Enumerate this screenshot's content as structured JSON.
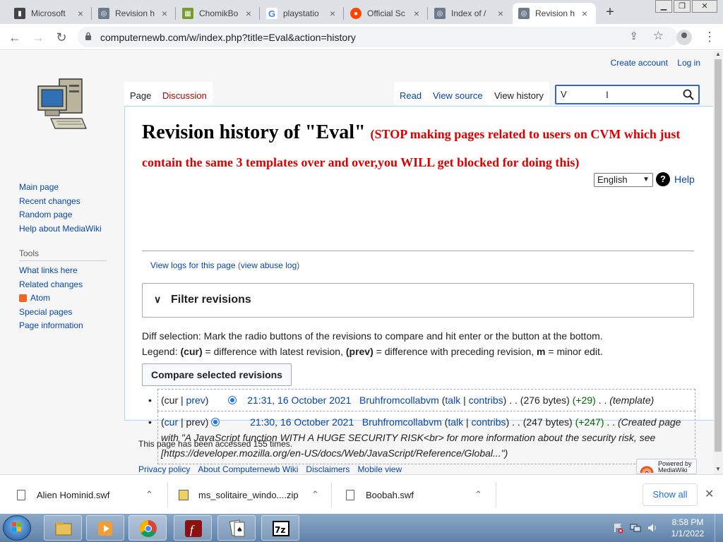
{
  "browser": {
    "tabs": [
      {
        "label": "Microsoft",
        "icon": "microsoft-icon"
      },
      {
        "label": "Revision h",
        "icon": "computernewb-icon"
      },
      {
        "label": "ChomikBo",
        "icon": "chomikbox-icon"
      },
      {
        "label": "playstatio",
        "icon": "google-icon"
      },
      {
        "label": "Official Sc",
        "icon": "reddit-icon"
      },
      {
        "label": "Index of /",
        "icon": "computernewb-icon"
      },
      {
        "label": "Revision h",
        "icon": "computernewb-icon",
        "active": true
      }
    ],
    "url": "computernewb.com/w/index.php?title=Eval&action=history"
  },
  "personal": {
    "create_account": "Create account",
    "log_in": "Log in"
  },
  "sidebar": {
    "nav": [
      "Main page",
      "Recent changes",
      "Random page",
      "Help about MediaWiki"
    ],
    "tools_heading": "Tools",
    "tools": [
      "What links here",
      "Related changes",
      "Atom",
      "Special pages",
      "Page information"
    ]
  },
  "tabs": {
    "page": "Page",
    "discussion": "Discussion",
    "read": "Read",
    "view_source": "View source",
    "view_history": "View history"
  },
  "search": {
    "value": "V"
  },
  "heading": {
    "title": "Revision history of \"Eval\"",
    "warning": "(STOP making pages related to users on CVM which just contain the same 3 templates over and over,you WILL get blocked for doing this)"
  },
  "language": {
    "selected": "English"
  },
  "help_label": "Help",
  "subtitle": {
    "view_logs": "View logs for this page",
    "abuse_open": " (",
    "abuse_log": "view abuse log",
    "abuse_close": ")"
  },
  "filter": {
    "label": "Filter revisions"
  },
  "legend": {
    "line1": "Diff selection: Mark the radio buttons of the revisions to compare and hit enter or the button at the bottom.",
    "line2_a": "Legend: ",
    "cur": "(cur)",
    "line2_b": " = difference with latest revision, ",
    "prev": "(prev)",
    "line2_c": " = difference with preceding revision, ",
    "m": "m",
    "line2_d": " = minor edit."
  },
  "compare_button": "Compare selected revisions",
  "history": [
    {
      "cur": "cur",
      "prev": "prev",
      "date": "21:31, 16 October 2021",
      "user": "Bruhfromcollabvm",
      "talk": "talk",
      "contribs": "contribs",
      "size": "(276 bytes)",
      "diff": "(+29)",
      "summary": "(template)"
    },
    {
      "cur": "cur",
      "prev": "prev",
      "date": "21:30, 16 October 2021",
      "user": "Bruhfromcollabvm",
      "talk": "talk",
      "contribs": "contribs",
      "size": "(247 bytes)",
      "diff": "(+247)",
      "summary": "(Created page with \"A JavaScript function WITH A HUGE SECURITY RISK<br> for more information about the security risk, see [https://developer.mozilla.org/en-US/docs/Web/JavaScript/Reference/Global...\")"
    }
  ],
  "footer": {
    "accessed": "This page has been accessed 155 times.",
    "links": [
      "Privacy policy",
      "About Computernewb Wiki",
      "Disclaimers",
      "Mobile view"
    ],
    "powered_line1": "Powered by",
    "powered_line2": "MediaWiki"
  },
  "downloads": {
    "items": [
      "Alien Hominid.swf",
      "ms_solitaire_windo....zip",
      "Boobah.swf"
    ],
    "show_all": "Show all"
  },
  "taskbar": {
    "time": "8:58 PM",
    "date": "1/1/2022"
  }
}
